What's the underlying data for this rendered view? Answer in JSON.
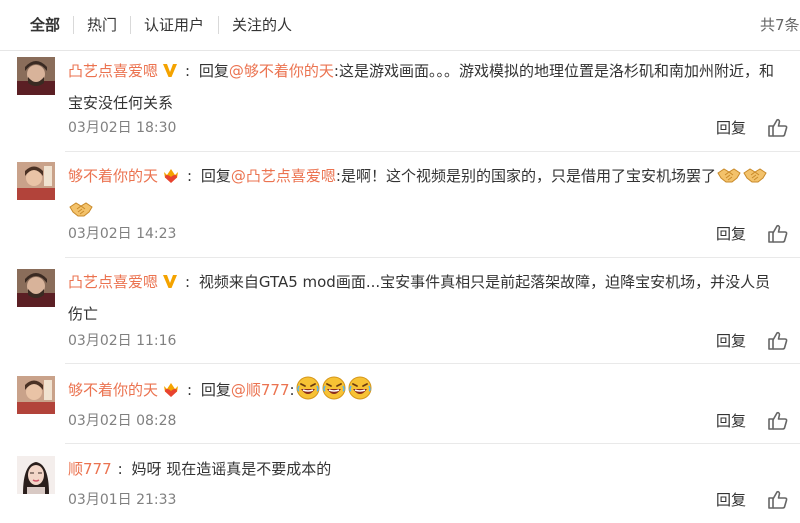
{
  "tabs": [
    {
      "label": "全部",
      "active": true
    },
    {
      "label": "热门",
      "active": false
    },
    {
      "label": "认证用户",
      "active": false
    },
    {
      "label": "关注的人",
      "active": false
    }
  ],
  "total": "共7条",
  "reply_label": "回复",
  "colors": {
    "accent": "#eb7350",
    "text": "#333333",
    "muted": "#808080",
    "divider": "#e9e9e9"
  },
  "comments": [
    {
      "user": "凸艺点喜爱嗯",
      "badge": "verified-v-icon",
      "prefix": "回复",
      "mention": "@够不着你的天",
      "text": ":这是游戏画面。。。游戏模拟的地理位置是洛杉矶和南加州附近，和宝安没任何关系",
      "time": "03月02日 18:30"
    },
    {
      "user": "够不着你的天",
      "badge": "crown-heart-icon",
      "prefix": "回复",
      "mention": "@凸艺点喜爱嗯",
      "text": ":是啊！这个视频是别的国家的，只是借用了宝安机场罢了",
      "emojis": [
        "handshake-emoji",
        "handshake-emoji",
        "handshake-emoji"
      ],
      "time": "03月02日 14:23"
    },
    {
      "user": "凸艺点喜爱嗯",
      "badge": "verified-v-icon",
      "text": "视频来自GTA5 mod画面...宝安事件真相只是前起落架故障，迫降宝安机场，并没人员伤亡",
      "time": "03月02日 11:16"
    },
    {
      "user": "够不着你的天",
      "badge": "crown-heart-icon",
      "prefix": "回复",
      "mention": "@顺777",
      "text": ":",
      "emojis": [
        "laughing-face-emoji",
        "laughing-face-emoji",
        "laughing-face-emoji"
      ],
      "time": "03月02日 08:28"
    },
    {
      "user": "顺777",
      "text": "妈呀 现在造谣真是不要成本的",
      "time": "03月01日 21:33"
    }
  ]
}
